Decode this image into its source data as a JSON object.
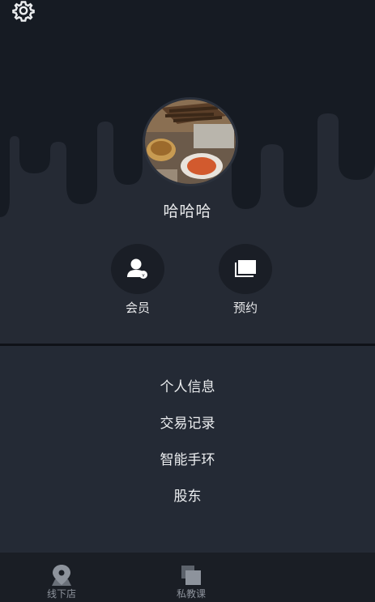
{
  "colors": {
    "header": "#161b23",
    "body": "#252a34",
    "menu_bg": "#242a35",
    "tabbar": "#1a1e25",
    "text": "#e8e9eb",
    "tab_text": "#8d939c"
  },
  "header": {
    "settings_icon": "gear-icon",
    "avatar_alt": "avatar photo",
    "username": "哈哈哈"
  },
  "actions": [
    {
      "label": "会员",
      "icon": "member-icon"
    },
    {
      "label": "预约",
      "icon": "booking-icon"
    }
  ],
  "menu": {
    "items": [
      "个人信息",
      "交易记录",
      "智能手环",
      "股东"
    ]
  },
  "tabbar": {
    "tabs": [
      {
        "label": "线下店",
        "icon": "location-pin-icon"
      },
      {
        "label": "私教课",
        "icon": "layers-icon"
      }
    ]
  }
}
